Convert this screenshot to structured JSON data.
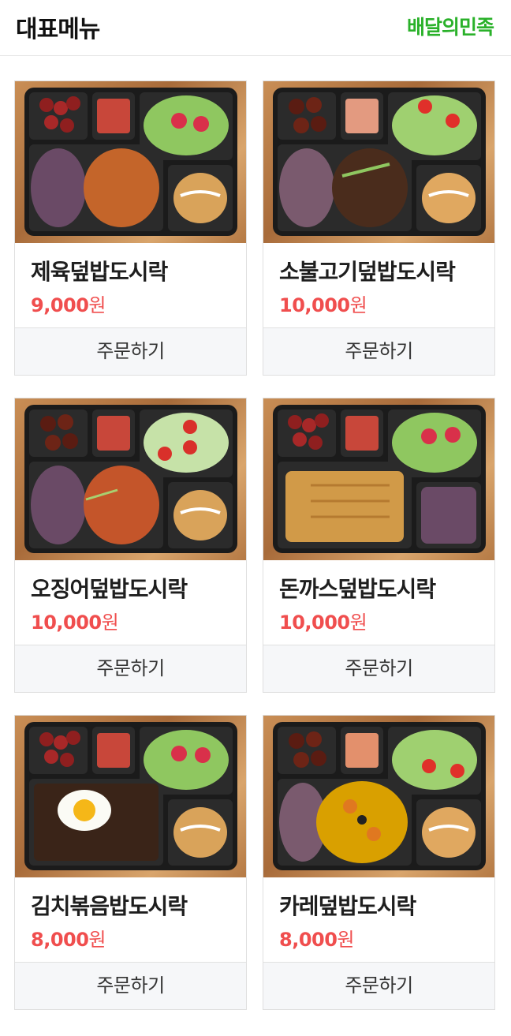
{
  "header": {
    "title": "대표메뉴",
    "brand": "배달의민족"
  },
  "menu": [
    {
      "name": "제육덮밥도시락",
      "price_number": "9,000",
      "price_unit": "원",
      "order_label": "주문하기",
      "main_dish": "spicy-pork"
    },
    {
      "name": "소불고기덮밥도시락",
      "price_number": "10,000",
      "price_unit": "원",
      "order_label": "주문하기",
      "main_dish": "bulgogi"
    },
    {
      "name": "오징어덮밥도시락",
      "price_number": "10,000",
      "price_unit": "원",
      "order_label": "주문하기",
      "main_dish": "squid"
    },
    {
      "name": "돈까스덮밥도시락",
      "price_number": "10,000",
      "price_unit": "원",
      "order_label": "주문하기",
      "main_dish": "pork-cutlet"
    },
    {
      "name": "김치볶음밥도시락",
      "price_number": "8,000",
      "price_unit": "원",
      "order_label": "주문하기",
      "main_dish": "kimchi-fried-rice"
    },
    {
      "name": "카레덮밥도시락",
      "price_number": "8,000",
      "price_unit": "원",
      "order_label": "주문하기",
      "main_dish": "curry"
    }
  ]
}
